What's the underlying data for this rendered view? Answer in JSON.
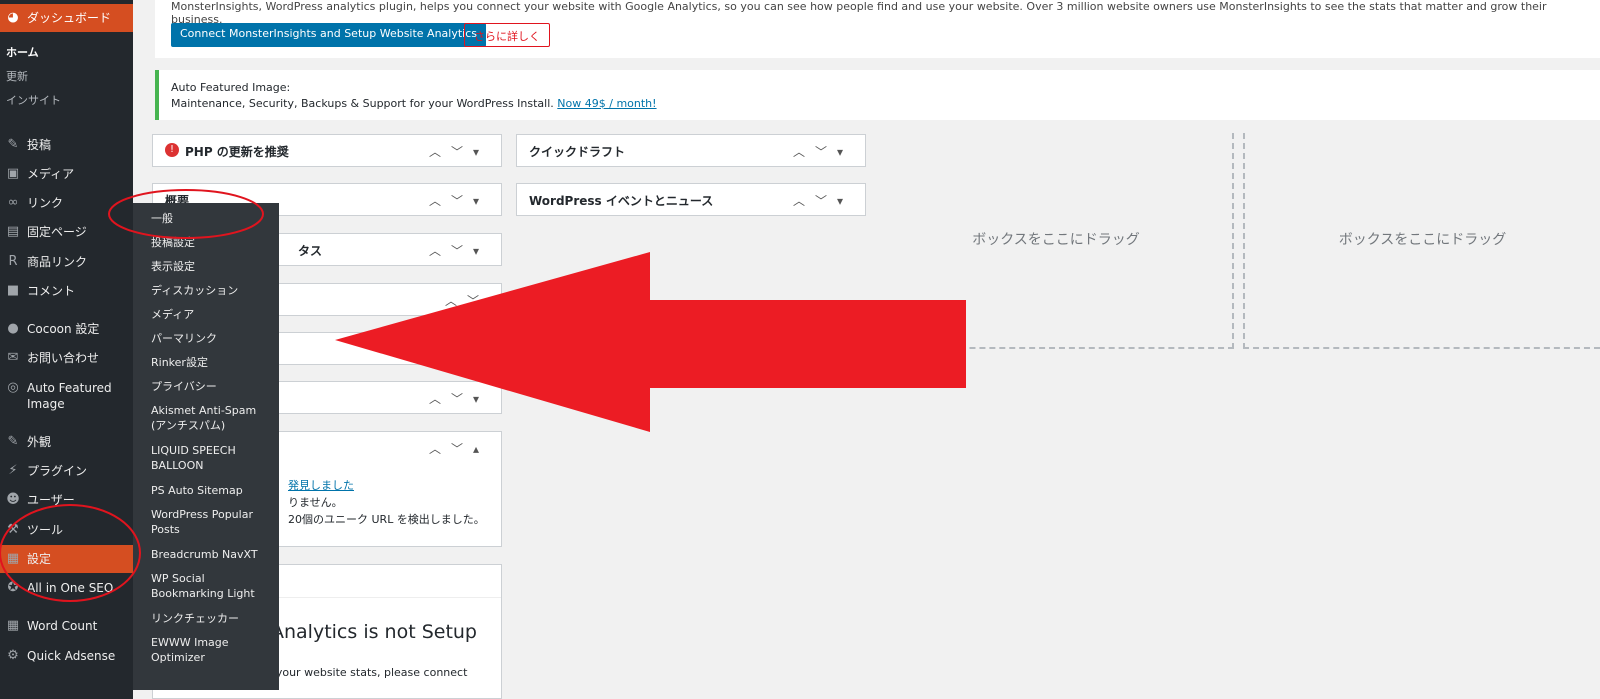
{
  "menu": {
    "dashboard": "ダッシュボード",
    "home": "ホーム",
    "updates": "更新",
    "insights": "インサイト",
    "items": [
      {
        "label": "投稿",
        "icon": "pin-icon"
      },
      {
        "label": "メディア",
        "icon": "media-icon"
      },
      {
        "label": "リンク",
        "icon": "link-icon"
      },
      {
        "label": "固定ページ",
        "icon": "page-icon"
      },
      {
        "label": "商品リンク",
        "icon": "r-icon"
      },
      {
        "label": "コメント",
        "icon": "comment-icon"
      },
      {
        "label": "Cocoon 設定",
        "icon": "cocoon-icon"
      },
      {
        "label": "お問い合わせ",
        "icon": "mail-icon"
      },
      {
        "label": "Auto Featured Image",
        "icon": "afi-icon"
      },
      {
        "label": "外観",
        "icon": "brush-icon"
      },
      {
        "label": "プラグイン",
        "icon": "plugin-icon"
      },
      {
        "label": "ユーザー",
        "icon": "user-icon"
      },
      {
        "label": "ツール",
        "icon": "wrench-icon"
      },
      {
        "label": "設定",
        "icon": "settings-icon"
      },
      {
        "label": "All in One SEO",
        "icon": "seo-icon"
      },
      {
        "label": "Word Count",
        "icon": "wordcount-icon"
      },
      {
        "label": "Quick Adsense",
        "icon": "gear-icon"
      }
    ]
  },
  "flyout": [
    "一般",
    "投稿設定",
    "表示設定",
    "ディスカッション",
    "メディア",
    "パーマリンク",
    "Rinker設定",
    "プライバシー",
    "Akismet Anti-Spam (アンチスパム)",
    "LIQUID SPEECH BALLOON",
    "PS Auto Sitemap",
    "WordPress Popular Posts",
    "Breadcrumb NavXT",
    "WP Social Bookmarking Light",
    "リンクチェッカー",
    "EWWW Image Optimizer"
  ],
  "notices": {
    "monster": "MonsterInsights, WordPress analytics plugin, helps you connect your website with Google Analytics, so you can see how people find and use your website. Over 3 million website owners use MonsterInsights to see the stats that matter and grow their business.",
    "connect_btn": "Connect MonsterInsights and Setup Website Analytics",
    "more_btn": "さらに詳しく",
    "afi_title": "Auto Featured Image:",
    "afi_text": "Maintenance, Security, Backups & Support for your WordPress Install.",
    "afi_link": "Now 49$ / month!"
  },
  "boxes": {
    "php": "PHP の更新を推奨",
    "quick": "クイックドラフト",
    "overview": "概要",
    "events": "WordPress イベントとニュース",
    "status": "タス",
    "found": "発見しました",
    "none": "りません。",
    "urls": "20個のユニーク URL を検出しました。",
    "analytics": "Analytics is not Setup",
    "analytics_sub": "To see your website stats, please connect",
    "drop": "ボックスをここにドラッグ"
  }
}
